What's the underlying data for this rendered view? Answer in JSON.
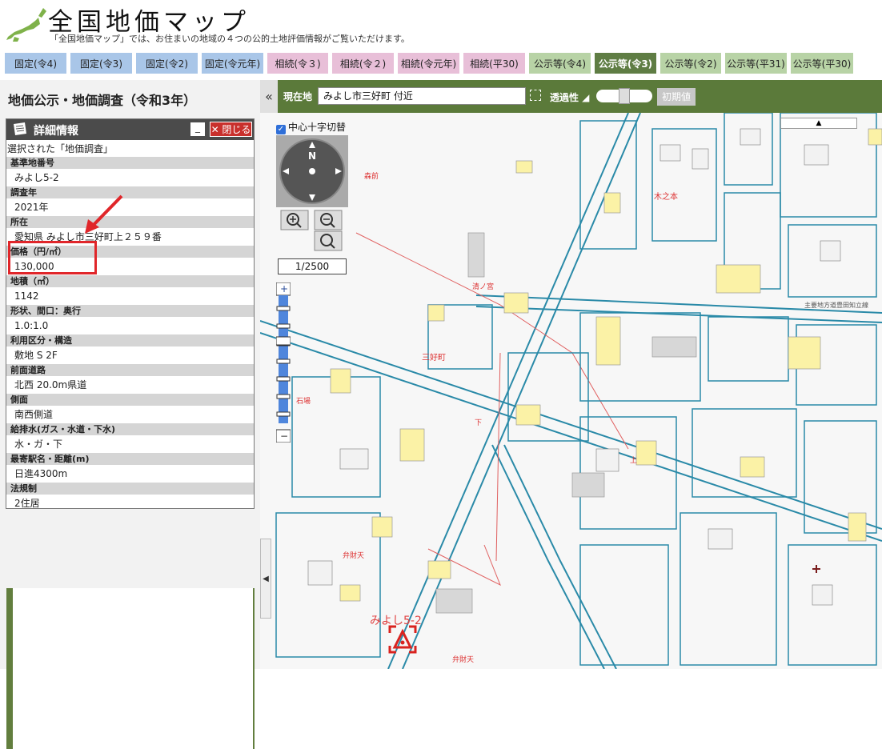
{
  "header": {
    "title": "全国地価マップ",
    "subtitle": "「全国地価マップ」では、お住まいの地域の４つの公的土地評価情報がご覧いただけます。"
  },
  "tabs": [
    {
      "label": "固定(令4)",
      "kind": "blue"
    },
    {
      "label": "固定(令3)",
      "kind": "blue"
    },
    {
      "label": "固定(令2)",
      "kind": "blue"
    },
    {
      "label": "固定(令元年)",
      "kind": "blue"
    },
    {
      "label": "相続(令３)",
      "kind": "pink"
    },
    {
      "label": "相続(令２)",
      "kind": "pink"
    },
    {
      "label": "相続(令元年)",
      "kind": "pink"
    },
    {
      "label": "相続(平30)",
      "kind": "pink"
    },
    {
      "label": "公示等(令4)",
      "kind": "green"
    },
    {
      "label": "公示等(令3)",
      "kind": "active"
    },
    {
      "label": "公示等(令2)",
      "kind": "green"
    },
    {
      "label": "公示等(平31)",
      "kind": "green"
    },
    {
      "label": "公示等(平30)",
      "kind": "green"
    }
  ],
  "left_panel": {
    "title": "地価公示・地価調査（令和3年）"
  },
  "detail": {
    "header": "詳細情報",
    "minimize": "_",
    "close": "✕ 閉じる",
    "selected": "選択された「地価調査」",
    "rows": [
      {
        "label": "基準地番号",
        "value": "みよし5-2"
      },
      {
        "label": "調査年",
        "value": "2021年"
      },
      {
        "label": "所在",
        "value": "愛知県 みよし市三好町上２５９番"
      },
      {
        "label": "価格（円/㎡）",
        "value": "130,000"
      },
      {
        "label": "地積（㎡）",
        "value": "1142"
      },
      {
        "label": "形状、間口：奥行",
        "value": "1.0:1.0"
      },
      {
        "label": "利用区分・構造",
        "value": "敷地 S 2F"
      },
      {
        "label": "前面道路",
        "value": "北西 20.0m県道"
      },
      {
        "label": "側面",
        "value": "南西側道"
      },
      {
        "label": "給排水(ガス・水道・下水)",
        "value": "水・ガ・下"
      },
      {
        "label": "最寄駅名・距離(m)",
        "value": "日進4300m"
      },
      {
        "label": "法規制",
        "value": "2住居"
      }
    ]
  },
  "toolbar": {
    "collapse": "«",
    "location_label": "現在地",
    "location_value": "みよし市三好町 付近",
    "transparency_label": "透過性 ◢",
    "reset": "初期値"
  },
  "map": {
    "center_cross_toggle": "中心十字切替",
    "scale": "1/2500",
    "compass": "N",
    "point_label": "みよし5-2",
    "labels": {
      "miyoshi": "三好町",
      "kinoki": "木之本",
      "ishiba": "石場",
      "benzaiten": "弁財天",
      "aokami": "清ノ宮",
      "shita": "下",
      "ue": "上",
      "morinomiya": "森前",
      "benzaiten2": "弁財天"
    },
    "road_label": "主要地方道豊田知立線"
  },
  "colors": {
    "active_tab": "#5f7d44",
    "toolbar_green": "#5b7a3a",
    "highlight_red": "#e0262a",
    "building_yellow": "#fbf2a6",
    "road_blue": "#2a8aa8"
  }
}
